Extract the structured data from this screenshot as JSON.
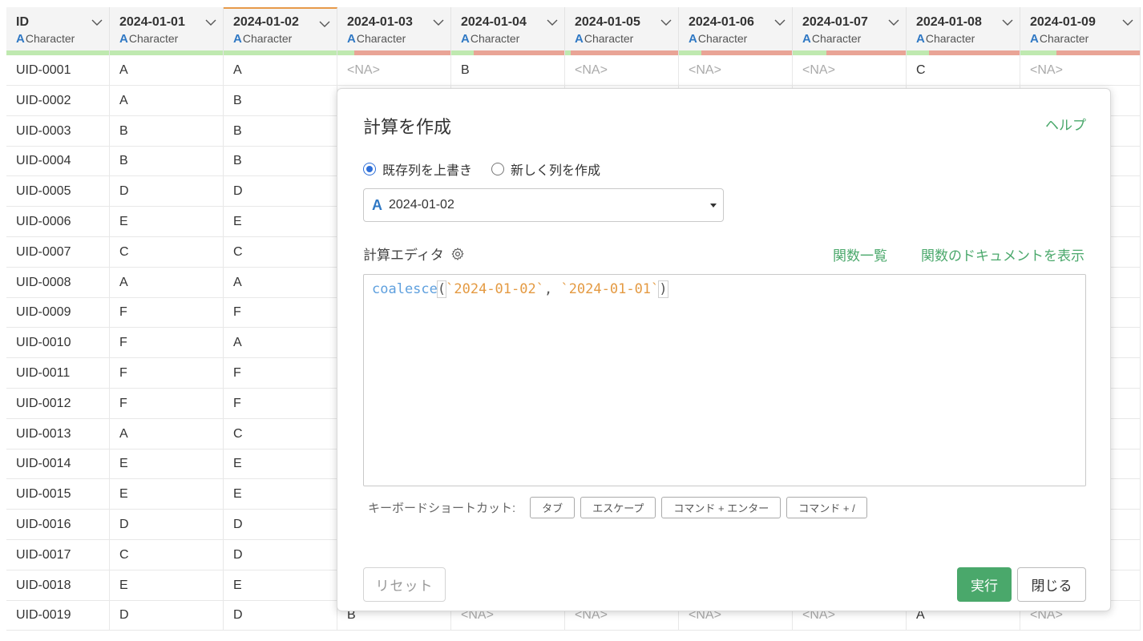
{
  "grid": {
    "columns": [
      {
        "title": "ID",
        "type": "Character",
        "ok": 1.0
      },
      {
        "title": "2024-01-01",
        "type": "Character",
        "ok": 1.0
      },
      {
        "title": "2024-01-02",
        "type": "Character",
        "ok": 1.0,
        "active": true
      },
      {
        "title": "2024-01-03",
        "type": "Character",
        "ok": 0.15
      },
      {
        "title": "2024-01-04",
        "type": "Character",
        "ok": 0.2
      },
      {
        "title": "2024-01-05",
        "type": "Character",
        "ok": 0.05
      },
      {
        "title": "2024-01-06",
        "type": "Character",
        "ok": 0.2
      },
      {
        "title": "2024-01-07",
        "type": "Character",
        "ok": 0.3
      },
      {
        "title": "2024-01-08",
        "type": "Character",
        "ok": 0.2
      },
      {
        "title": "2024-01-09",
        "type": "Character",
        "ok": 0.3
      }
    ],
    "rows": [
      [
        "UID-0001",
        "A",
        "A",
        "<NA>",
        "B",
        "<NA>",
        "<NA>",
        "<NA>",
        "C",
        "<NA>"
      ],
      [
        "UID-0002",
        "A",
        "B"
      ],
      [
        "UID-0003",
        "B",
        "B"
      ],
      [
        "UID-0004",
        "B",
        "B"
      ],
      [
        "UID-0005",
        "D",
        "D"
      ],
      [
        "UID-0006",
        "E",
        "E"
      ],
      [
        "UID-0007",
        "C",
        "C"
      ],
      [
        "UID-0008",
        "A",
        "A"
      ],
      [
        "UID-0009",
        "F",
        "F"
      ],
      [
        "UID-0010",
        "F",
        "A"
      ],
      [
        "UID-0011",
        "F",
        "F"
      ],
      [
        "UID-0012",
        "F",
        "F"
      ],
      [
        "UID-0013",
        "A",
        "C"
      ],
      [
        "UID-0014",
        "E",
        "E"
      ],
      [
        "UID-0015",
        "E",
        "E"
      ],
      [
        "UID-0016",
        "D",
        "D"
      ],
      [
        "UID-0017",
        "C",
        "D"
      ],
      [
        "UID-0018",
        "E",
        "E"
      ],
      [
        "UID-0019",
        "D",
        "D",
        "B",
        "<NA>",
        "<NA>",
        "<NA>",
        "<NA>",
        "A",
        "<NA>"
      ]
    ]
  },
  "dialog": {
    "title": "計算を作成",
    "help": "ヘルプ",
    "radio_overwrite": "既存列を上書き",
    "radio_new": "新しく列を作成",
    "column_select": {
      "icon": "A",
      "value": "2024-01-02"
    },
    "editor_label": "計算エディタ",
    "function_list": "関数一覧",
    "function_docs": "関数のドキュメントを表示",
    "code": {
      "fn": "coalesce",
      "open": "(",
      "arg1": "`2024-01-02`",
      "sep": ", ",
      "arg2": "`2024-01-01`",
      "close": ")"
    },
    "shortcuts_label": "キーボードショートカット:",
    "shortcuts": [
      "タブ",
      "エスケープ",
      "コマンド + エンター",
      "コマンド + /"
    ],
    "reset": "リセット",
    "run": "実行",
    "close": "閉じる"
  },
  "colors": {
    "accent_green": "#4aa86b",
    "type_blue": "#2f78c4",
    "ok_bar": "#bfe9b0",
    "na_bar": "#e9a496",
    "string": "#e49a42",
    "function": "#5fa0de"
  }
}
